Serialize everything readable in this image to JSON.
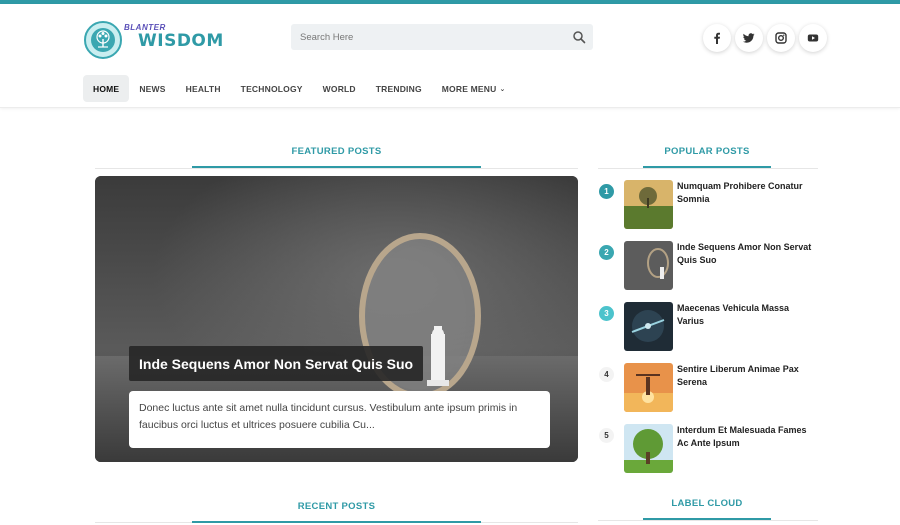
{
  "brand": {
    "tagline": "BLANTER",
    "name": "WISDOM"
  },
  "search": {
    "placeholder": "Search Here"
  },
  "social": [
    {
      "icon": "facebook-icon"
    },
    {
      "icon": "twitter-icon"
    },
    {
      "icon": "instagram-icon"
    },
    {
      "icon": "youtube-icon"
    }
  ],
  "nav": {
    "items": [
      "HOME",
      "NEWS",
      "HEALTH",
      "TECHNOLOGY",
      "WORLD",
      "TRENDING",
      "MORE MENU"
    ],
    "active": "HOME"
  },
  "sections": {
    "featured": "FEATURED POSTS",
    "popular": "POPULAR POSTS",
    "recent": "RECENT POSTS",
    "labels": "LABEL CLOUD"
  },
  "featured": {
    "title": "Inde Sequens Amor Non Servat Quis Suo",
    "snippet": "Donec luctus ante sit amet nulla tincidunt cursus. Vestibulum ante ipsum primis in faucibus orci luctus et ultrices posuere cubilia Cu..."
  },
  "popular": [
    {
      "rank": "1",
      "title": "Numquam Prohibere Conatur Somnia"
    },
    {
      "rank": "2",
      "title": "Inde Sequens Amor Non Servat Quis Suo"
    },
    {
      "rank": "3",
      "title": "Maecenas Vehicula Massa Varius"
    },
    {
      "rank": "4",
      "title": "Sentire Liberum Animae Pax Serena"
    },
    {
      "rank": "5",
      "title": "Interdum Et Malesuada Fames Ac Ante Ipsum"
    }
  ],
  "colors": {
    "accent": "#2f9aa6",
    "rank_1": "#2f9aa6",
    "rank_2": "#3aa7b1",
    "rank_3": "#4cc3cc"
  }
}
